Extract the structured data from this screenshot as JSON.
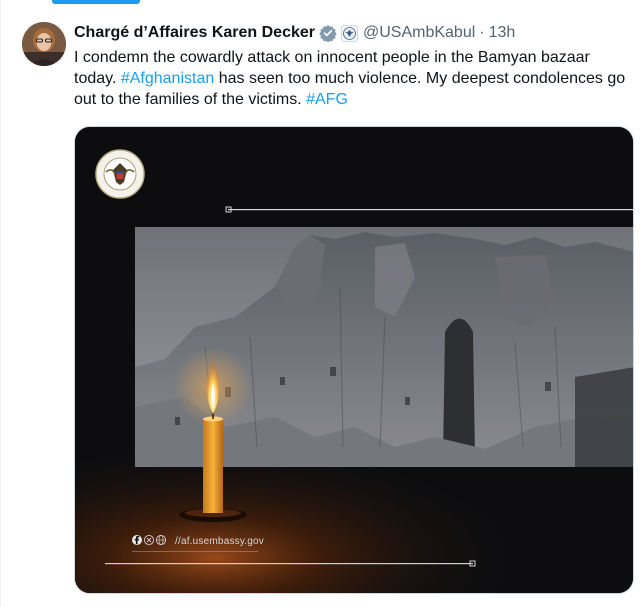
{
  "tweet": {
    "author_name": "Chargé d’Affaires Karen Decker",
    "handle": "@USAmbKabul",
    "separator": "·",
    "time": "13h",
    "text_part1": "I condemn the cowardly attack on innocent people in the Bamyan bazaar today. ",
    "hashtag1": "#Afghanistan",
    "text_part2": " has seen too much violence. My deepest condolences go out to the families of the victims. ",
    "hashtag2": "#AFG"
  },
  "media": {
    "url_text": "//af.usembassy.gov",
    "colors": {
      "candle": "#f2a62a",
      "flame": "#ffd36a",
      "glow": "#8a3d12",
      "background": "#0d0d0f"
    }
  },
  "icons": [
    "verified-icon",
    "embassy-seal-icon",
    "facebook-icon",
    "x-icon",
    "globe-icon"
  ]
}
